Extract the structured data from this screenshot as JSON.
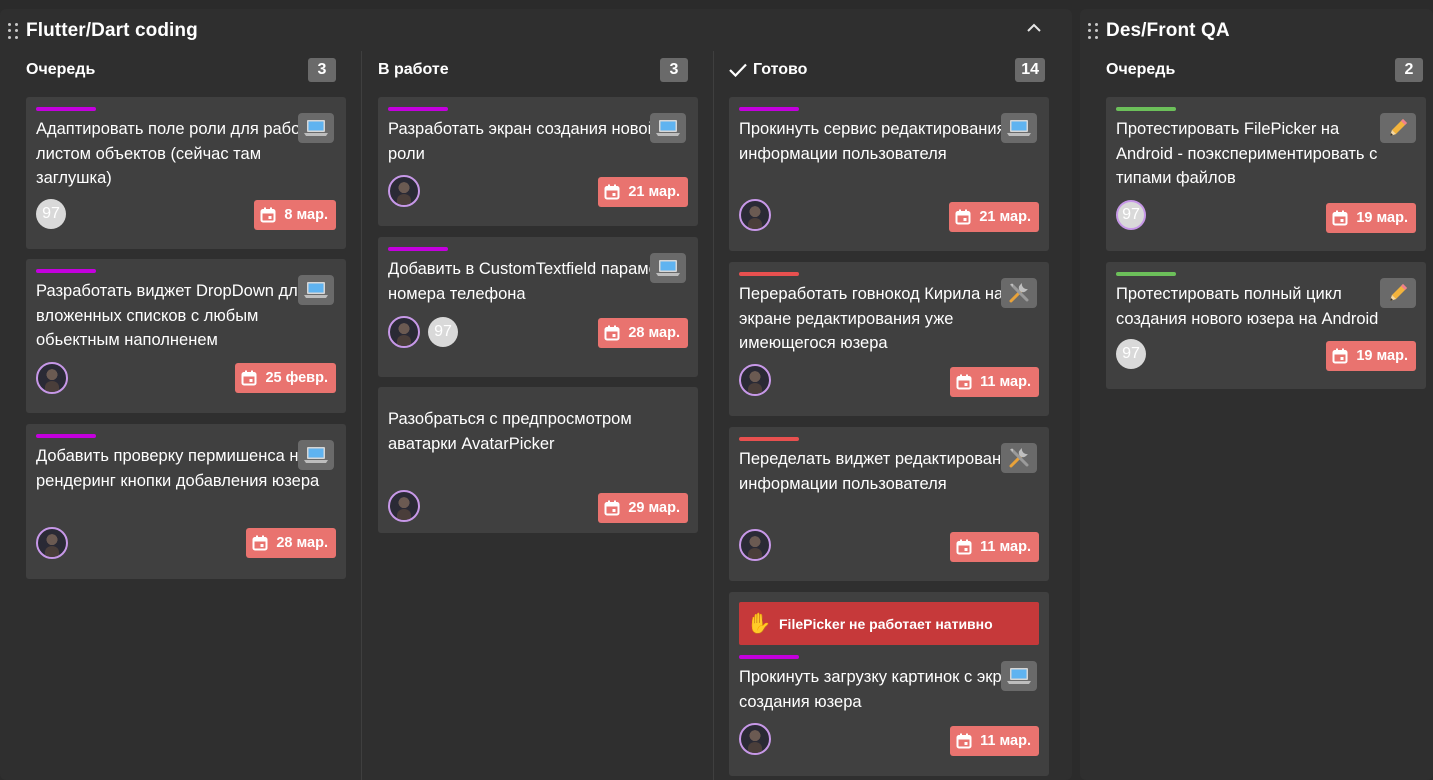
{
  "boards": [
    {
      "title": "Flutter/Dart coding",
      "columns": [
        {
          "title": "Очередь",
          "count": "3"
        },
        {
          "title": "В работе",
          "count": "3"
        },
        {
          "title": "Готово",
          "count": "14"
        }
      ]
    },
    {
      "title": "Des/Front QA",
      "columns": [
        {
          "title": "Очередь",
          "count": "2"
        }
      ]
    }
  ],
  "cards": {
    "c1": {
      "title": "Адаптировать поле роли для работы с листом объектов (сейчас там заглушка)",
      "icon": "laptop-icon",
      "tag_color": "#c400de",
      "assignee_badge": "97",
      "due": "8 мар."
    },
    "c2": {
      "title": "Разработать виджет DropDown для вложенных списков с любым обьектным наполненем",
      "icon": "laptop-icon",
      "tag_color": "#c400de",
      "due": "25 февр."
    },
    "c3": {
      "title": "Добавить проверку пермишенса на рендеринг кнопки добавления юзера",
      "icon": "laptop-icon",
      "tag_color": "#c400de",
      "due": "28 мар."
    },
    "c4": {
      "title": "Разработать экран создания новой роли",
      "icon": "laptop-icon",
      "tag_color": "#c400de",
      "due": "21 мар."
    },
    "c5": {
      "title": "Добавить в CustomTextfield параметр номера телефона",
      "icon": "laptop-icon",
      "tag_color": "#c400de",
      "assignee_badge": "97",
      "due": "28 мар."
    },
    "c6": {
      "title": "Разобраться с предпросмотром аватарки AvatarPicker",
      "due": "29 мар."
    },
    "c7": {
      "title": "Прокинуть сервис редактирования информации пользователя",
      "icon": "laptop-icon",
      "tag_color": "#c400de",
      "due": "21 мар."
    },
    "c8": {
      "title": "Переработать говнокод Кирила на экране редактирования уже имеющегося юзера",
      "icon": "tools-icon",
      "tag_color": "#e8504f",
      "due": "11 мар."
    },
    "c9": {
      "title": "Переделать виджет редактирования информации пользователя",
      "icon": "tools-icon",
      "tag_color": "#e8504f",
      "due": "11 мар."
    },
    "c10": {
      "title": "Прокинуть загрузку картинок с экрана создания юзера",
      "icon": "laptop-icon",
      "tag_color": "#c400de",
      "blocker": "FilePicker не работает нативно",
      "due": "11 мар."
    },
    "c11": {
      "title": "Протестировать FilePicker на Android - поэкспериментировать с типами файлов",
      "icon": "pencil-icon",
      "tag_color": "#6cc05a",
      "assignee_badge": "97",
      "due": "19 мар."
    },
    "c12": {
      "title": "Протестировать полный цикл создания нового юзера на Android",
      "icon": "pencil-icon",
      "tag_color": "#6cc05a",
      "assignee_badge": "97",
      "due": "19 мар."
    }
  }
}
